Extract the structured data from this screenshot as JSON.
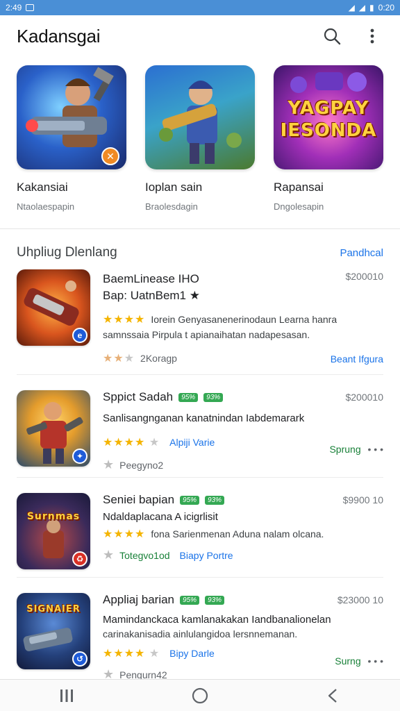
{
  "status_bar": {
    "time": "2:49",
    "right_text": "0:20"
  },
  "app_bar": {
    "title": "Kadansgai",
    "search_icon": "search-icon",
    "menu_icon": "more-vert-icon"
  },
  "featured": [
    {
      "name": "Kakansiai",
      "subtitle": "Ntaolaespapin"
    },
    {
      "name": "Ioplan sain",
      "subtitle": "Braolesdagin"
    },
    {
      "name": "Rapansai",
      "subtitle": "Dngolesapin",
      "tile_text": "YAGPAY IESONDA"
    }
  ],
  "section": {
    "title": "Uhpliug Dlenlang",
    "link": "Pandhcal"
  },
  "list": [
    {
      "title": "BaemLinease IHO",
      "title2": "Bap: UatnBem1 ★",
      "price": "$200010",
      "desc1": "Iorein Genyasanenerinodaun Learna hanra",
      "desc2": "samnssaia Pirpula t apianaihatan nadapesasan.",
      "meta": "2Koragp",
      "action": "Beant Ifgura"
    },
    {
      "title": "Sppict Sadah",
      "tag1": "95%",
      "tag2": "93%",
      "price": "$200010",
      "desc1": "Sanlisangnganan kanatnindan Iabdemarark",
      "link": "Alpiji Varie",
      "meta": "Peegyno2",
      "action": "Sprung"
    },
    {
      "title": "Seniei bapian",
      "tag1": "95%",
      "tag2": "93%",
      "price": "$9900 10",
      "desc1": "Ndaldaplacana A icigrlisit",
      "desc2": "fona Sarienmenan Aduna nalam olcana.",
      "icon_text": "Surnmas",
      "meta": "Totegvo1od",
      "link": "Biapy Portre"
    },
    {
      "title": "Appliaj barian",
      "tag1": "95%",
      "tag2": "93%",
      "price": "$23000 10",
      "desc1": "Mamindanckaca kamlanakakan Iandbanalionelan",
      "desc2": "carinakanisadia ainlulangidoa lersnnemanan.",
      "icon_text": "SIGNAIER",
      "link": "Bipy Darle",
      "meta": "Pengurn42",
      "action": "Surng"
    }
  ],
  "colors": {
    "accent": "#1a73e8",
    "status_bar": "#4a8fd6",
    "star": "#f4b400",
    "tag": "#34a853"
  }
}
